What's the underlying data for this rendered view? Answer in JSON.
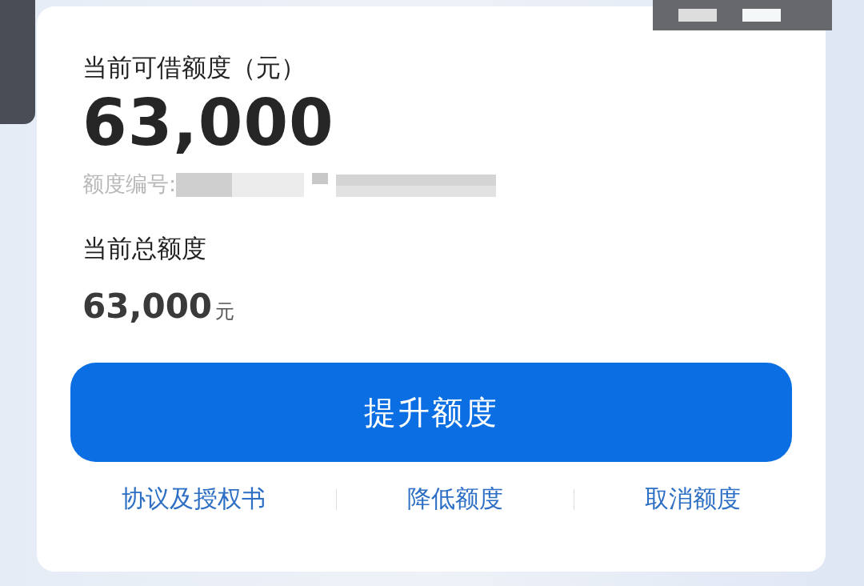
{
  "available": {
    "label": "当前可借额度（元）",
    "amount": "63,000",
    "number_label": "额度编号:"
  },
  "total": {
    "label": "当前总额度",
    "amount": "63,000",
    "unit": "元"
  },
  "primary_button": "提升额度",
  "links": [
    "协议及授权书",
    "降低额度",
    "取消额度"
  ]
}
